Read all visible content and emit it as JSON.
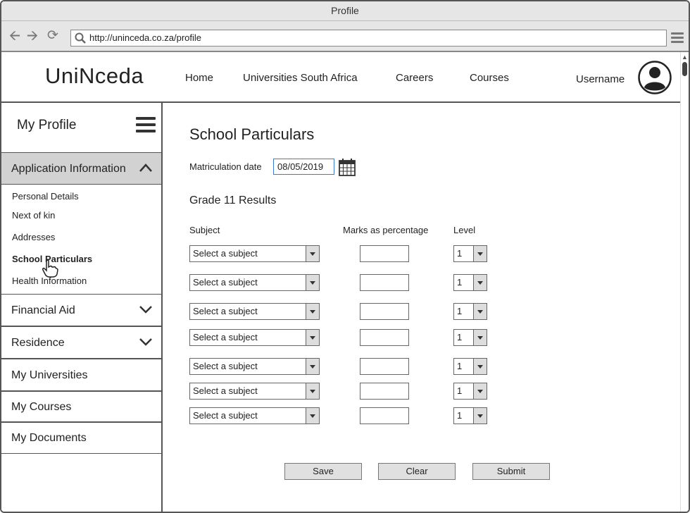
{
  "window": {
    "title": "Profile"
  },
  "browser": {
    "url": "http://uninceda.co.za/profile"
  },
  "site": {
    "logo": "UniNceda",
    "nav": [
      "Home",
      "Universities South Africa",
      "Careers",
      "Courses"
    ],
    "username": "Username"
  },
  "sidebar": {
    "title": "My Profile",
    "sections": [
      {
        "label": "Application Information",
        "expanded": true
      },
      {
        "label": "Financial Aid",
        "expanded": false
      },
      {
        "label": "Residence",
        "expanded": false
      },
      {
        "label": "My Universities"
      },
      {
        "label": "My Courses"
      },
      {
        "label": "My Documents"
      }
    ],
    "subitems": [
      "Personal Details",
      "Next of kin",
      "Addresses",
      "School Particulars",
      "Health Information"
    ],
    "active_subitem": "School Particulars"
  },
  "main": {
    "title": "School Particulars",
    "matric_label": "Matriculation date",
    "matric_value": "08/05/2019",
    "grade_title": "Grade 11 Results",
    "col_subject": "Subject",
    "col_marks": "Marks as percentage",
    "col_level": "Level",
    "rows": [
      {
        "subject": "Select a subject",
        "marks": "",
        "level": "1"
      },
      {
        "subject": "Select a subject",
        "marks": "",
        "level": "1"
      },
      {
        "subject": "Select a subject",
        "marks": "",
        "level": "1"
      },
      {
        "subject": "Select a subject",
        "marks": "",
        "level": "1"
      },
      {
        "subject": "Select a subject",
        "marks": "",
        "level": "1"
      },
      {
        "subject": "Select a subject",
        "marks": "",
        "level": "1"
      },
      {
        "subject": "Select a subject",
        "marks": "",
        "level": "1"
      }
    ],
    "buttons": {
      "save": "Save",
      "clear": "Clear",
      "submit": "Submit"
    }
  }
}
